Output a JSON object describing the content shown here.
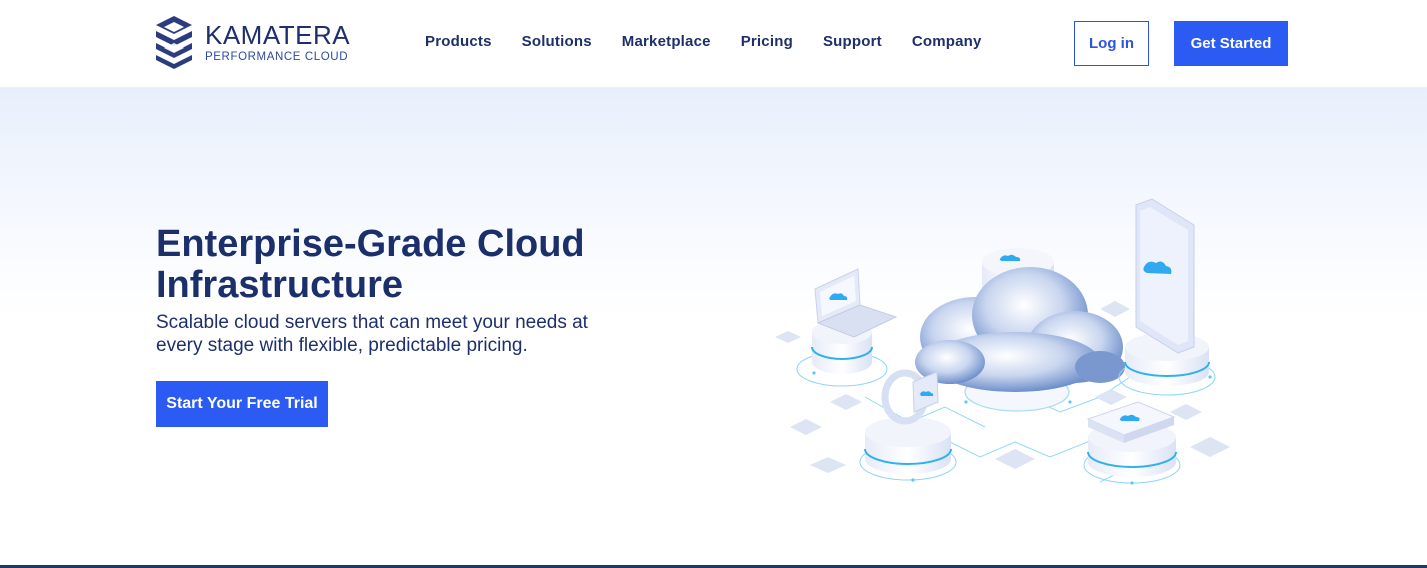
{
  "brand": {
    "name": "KAMATERA",
    "tagline": "PERFORMANCE CLOUD",
    "logo_icon": "kamatera-logo-icon",
    "color": "#2b3d7f"
  },
  "nav": {
    "items": [
      {
        "label": "Products"
      },
      {
        "label": "Solutions"
      },
      {
        "label": "Marketplace"
      },
      {
        "label": "Pricing"
      },
      {
        "label": "Support"
      },
      {
        "label": "Company"
      }
    ]
  },
  "header": {
    "login_label": "Log in",
    "get_started_label": "Get Started"
  },
  "hero": {
    "title": "Enterprise-Grade Cloud Infrastructure",
    "subtitle": "Scalable cloud servers that can meet your needs at every stage with flexible, predictable pricing.",
    "cta_label": "Start Your Free Trial",
    "illustration": "cloud-network-illustration"
  },
  "colors": {
    "accent": "#2b5bf2",
    "navy": "#1b2f6b",
    "hero_bg": "#e8effc"
  }
}
